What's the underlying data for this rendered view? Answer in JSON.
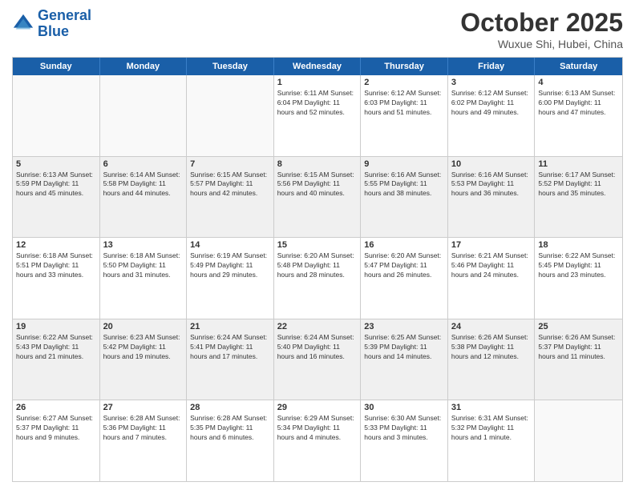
{
  "header": {
    "logo_line1": "General",
    "logo_line2": "Blue",
    "month": "October 2025",
    "location": "Wuxue Shi, Hubei, China"
  },
  "weekdays": [
    "Sunday",
    "Monday",
    "Tuesday",
    "Wednesday",
    "Thursday",
    "Friday",
    "Saturday"
  ],
  "rows": [
    [
      {
        "day": "",
        "info": ""
      },
      {
        "day": "",
        "info": ""
      },
      {
        "day": "",
        "info": ""
      },
      {
        "day": "1",
        "info": "Sunrise: 6:11 AM\nSunset: 6:04 PM\nDaylight: 11 hours\nand 52 minutes."
      },
      {
        "day": "2",
        "info": "Sunrise: 6:12 AM\nSunset: 6:03 PM\nDaylight: 11 hours\nand 51 minutes."
      },
      {
        "day": "3",
        "info": "Sunrise: 6:12 AM\nSunset: 6:02 PM\nDaylight: 11 hours\nand 49 minutes."
      },
      {
        "day": "4",
        "info": "Sunrise: 6:13 AM\nSunset: 6:00 PM\nDaylight: 11 hours\nand 47 minutes."
      }
    ],
    [
      {
        "day": "5",
        "info": "Sunrise: 6:13 AM\nSunset: 5:59 PM\nDaylight: 11 hours\nand 45 minutes."
      },
      {
        "day": "6",
        "info": "Sunrise: 6:14 AM\nSunset: 5:58 PM\nDaylight: 11 hours\nand 44 minutes."
      },
      {
        "day": "7",
        "info": "Sunrise: 6:15 AM\nSunset: 5:57 PM\nDaylight: 11 hours\nand 42 minutes."
      },
      {
        "day": "8",
        "info": "Sunrise: 6:15 AM\nSunset: 5:56 PM\nDaylight: 11 hours\nand 40 minutes."
      },
      {
        "day": "9",
        "info": "Sunrise: 6:16 AM\nSunset: 5:55 PM\nDaylight: 11 hours\nand 38 minutes."
      },
      {
        "day": "10",
        "info": "Sunrise: 6:16 AM\nSunset: 5:53 PM\nDaylight: 11 hours\nand 36 minutes."
      },
      {
        "day": "11",
        "info": "Sunrise: 6:17 AM\nSunset: 5:52 PM\nDaylight: 11 hours\nand 35 minutes."
      }
    ],
    [
      {
        "day": "12",
        "info": "Sunrise: 6:18 AM\nSunset: 5:51 PM\nDaylight: 11 hours\nand 33 minutes."
      },
      {
        "day": "13",
        "info": "Sunrise: 6:18 AM\nSunset: 5:50 PM\nDaylight: 11 hours\nand 31 minutes."
      },
      {
        "day": "14",
        "info": "Sunrise: 6:19 AM\nSunset: 5:49 PM\nDaylight: 11 hours\nand 29 minutes."
      },
      {
        "day": "15",
        "info": "Sunrise: 6:20 AM\nSunset: 5:48 PM\nDaylight: 11 hours\nand 28 minutes."
      },
      {
        "day": "16",
        "info": "Sunrise: 6:20 AM\nSunset: 5:47 PM\nDaylight: 11 hours\nand 26 minutes."
      },
      {
        "day": "17",
        "info": "Sunrise: 6:21 AM\nSunset: 5:46 PM\nDaylight: 11 hours\nand 24 minutes."
      },
      {
        "day": "18",
        "info": "Sunrise: 6:22 AM\nSunset: 5:45 PM\nDaylight: 11 hours\nand 23 minutes."
      }
    ],
    [
      {
        "day": "19",
        "info": "Sunrise: 6:22 AM\nSunset: 5:43 PM\nDaylight: 11 hours\nand 21 minutes."
      },
      {
        "day": "20",
        "info": "Sunrise: 6:23 AM\nSunset: 5:42 PM\nDaylight: 11 hours\nand 19 minutes."
      },
      {
        "day": "21",
        "info": "Sunrise: 6:24 AM\nSunset: 5:41 PM\nDaylight: 11 hours\nand 17 minutes."
      },
      {
        "day": "22",
        "info": "Sunrise: 6:24 AM\nSunset: 5:40 PM\nDaylight: 11 hours\nand 16 minutes."
      },
      {
        "day": "23",
        "info": "Sunrise: 6:25 AM\nSunset: 5:39 PM\nDaylight: 11 hours\nand 14 minutes."
      },
      {
        "day": "24",
        "info": "Sunrise: 6:26 AM\nSunset: 5:38 PM\nDaylight: 11 hours\nand 12 minutes."
      },
      {
        "day": "25",
        "info": "Sunrise: 6:26 AM\nSunset: 5:37 PM\nDaylight: 11 hours\nand 11 minutes."
      }
    ],
    [
      {
        "day": "26",
        "info": "Sunrise: 6:27 AM\nSunset: 5:37 PM\nDaylight: 11 hours\nand 9 minutes."
      },
      {
        "day": "27",
        "info": "Sunrise: 6:28 AM\nSunset: 5:36 PM\nDaylight: 11 hours\nand 7 minutes."
      },
      {
        "day": "28",
        "info": "Sunrise: 6:28 AM\nSunset: 5:35 PM\nDaylight: 11 hours\nand 6 minutes."
      },
      {
        "day": "29",
        "info": "Sunrise: 6:29 AM\nSunset: 5:34 PM\nDaylight: 11 hours\nand 4 minutes."
      },
      {
        "day": "30",
        "info": "Sunrise: 6:30 AM\nSunset: 5:33 PM\nDaylight: 11 hours\nand 3 minutes."
      },
      {
        "day": "31",
        "info": "Sunrise: 6:31 AM\nSunset: 5:32 PM\nDaylight: 11 hours\nand 1 minute."
      },
      {
        "day": "",
        "info": ""
      }
    ]
  ]
}
